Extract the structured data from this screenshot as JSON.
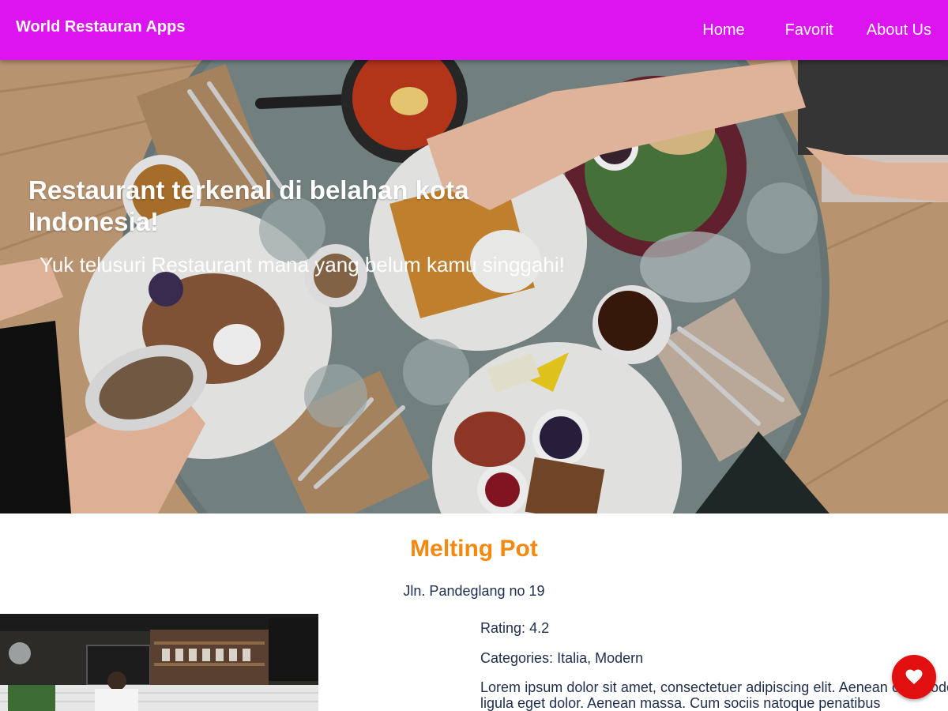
{
  "header": {
    "brand": "World Restauran Apps",
    "nav": [
      "Home",
      "Favorit",
      "About Us"
    ]
  },
  "hero": {
    "title": "Restaurant terkenal di belahan kota Indonesia!",
    "subtitle": "Yuk telusuri Restaurant mana yang belum kamu singgahi!",
    "image_icon": "restaurant-table-photo"
  },
  "restaurant": {
    "name": "Melting Pot",
    "address": "Jln. Pandeglang no 19",
    "rating_label": "Rating:",
    "rating_value": "4.2",
    "categories_label": "Categories:",
    "categories_value": "Italia, Modern",
    "description": "Lorem ipsum dolor sit amet, consectetuer adipiscing elit. Aenean commodo ligula eget dolor. Aenean massa. Cum sociis natoque penatibus",
    "image_icon": "restaurant-kitchen-photo"
  },
  "favorite_button": {
    "icon": "heart-icon"
  },
  "colors": {
    "appbar": "#dc14f0",
    "accent_title": "#f5890f",
    "favorite": "#e10f0f",
    "text": "#1f2d4d"
  }
}
